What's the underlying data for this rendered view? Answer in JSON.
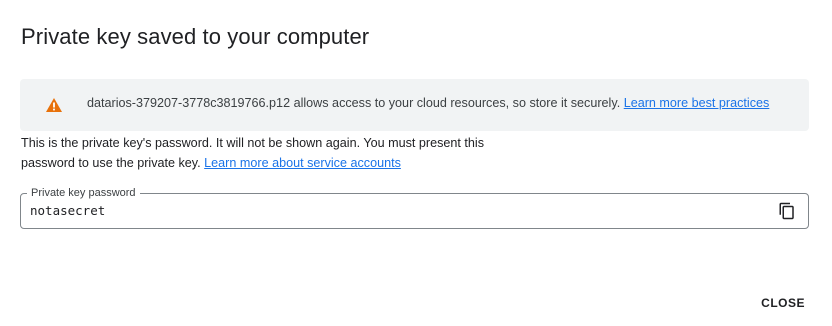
{
  "dialog": {
    "title": "Private key saved to your computer"
  },
  "warning": {
    "icon": "warning-icon",
    "icon_color": "#e8710a",
    "message": "datarios-379207-3778c3819766.p12 allows access to your cloud resources, so store it securely.",
    "link_text": "Learn more best practices"
  },
  "info": {
    "line1": "This is the private key's password. It will not be shown again. You must present this",
    "line2": "password to use the private key.",
    "link_text": "Learn more about service accounts"
  },
  "password_field": {
    "label": "Private key password",
    "value": "notasecret",
    "copy_icon": "copy-icon"
  },
  "actions": {
    "close_label": "CLOSE"
  },
  "colors": {
    "link": "#1a73e8",
    "banner_bg": "#f1f3f4"
  }
}
